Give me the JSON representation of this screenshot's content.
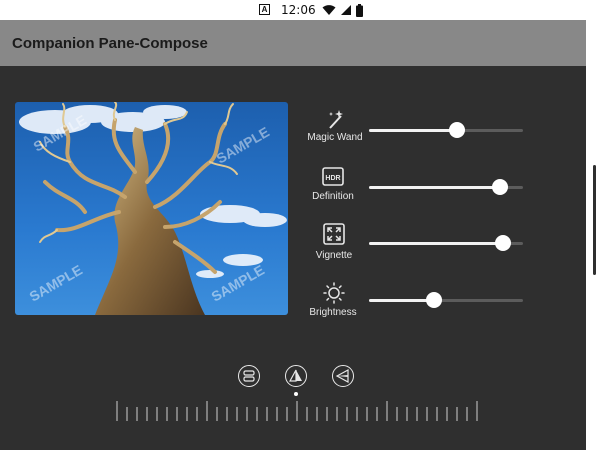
{
  "status_bar": {
    "app_badge": "A",
    "time": "12:06",
    "icons": [
      "wifi-icon",
      "signal-icon",
      "battery-icon"
    ]
  },
  "app_bar": {
    "title": "Companion Pane-Compose"
  },
  "photo": {
    "description_icon": "photo-of-bristlecone-pine",
    "watermark": "SAMPLE"
  },
  "adjustments": [
    {
      "icon": "magic-wand-icon",
      "label": "Magic Wand",
      "value": 0.57
    },
    {
      "icon": "hdr-icon",
      "label": "Definition",
      "badge": "HDR",
      "value": 0.85
    },
    {
      "icon": "vignette-icon",
      "label": "Vignette",
      "value": 0.87
    },
    {
      "icon": "brightness-icon",
      "label": "Brightness",
      "value": 0.42
    }
  ],
  "mode_icons": [
    {
      "icon": "layers-icon",
      "selected": false
    },
    {
      "icon": "triangle-filter-icon",
      "selected": true
    },
    {
      "icon": "triangle-left-icon",
      "selected": false
    }
  ],
  "colors": {
    "background": "#2f2f2f",
    "app_bar": "#888888",
    "accent": "#ffffff"
  }
}
